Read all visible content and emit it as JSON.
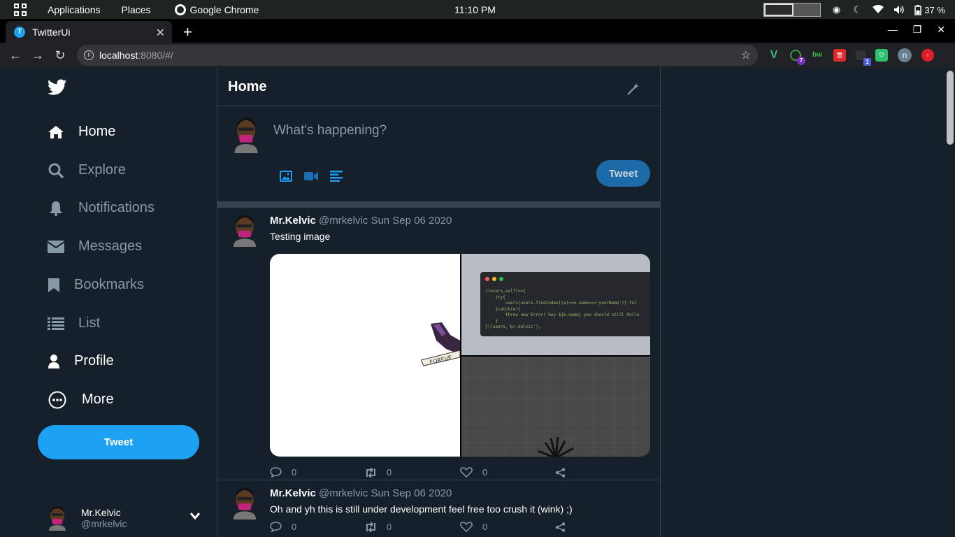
{
  "os_bar": {
    "applications": "Applications",
    "places": "Places",
    "chrome": "Google Chrome",
    "clock": "11:10 PM",
    "battery": "37 %"
  },
  "browser": {
    "tab_title": "TwitterUi",
    "tab_favicon": "T",
    "url_host": "localhost",
    "url_rest": ":8080/#/",
    "profile_initial": "n",
    "ext_badge_1": "7",
    "ext_badge_2": "1",
    "ext_bw": "bw"
  },
  "sidebar": {
    "items": [
      {
        "label": "Home",
        "icon": "home-icon"
      },
      {
        "label": "Explore",
        "icon": "search-icon"
      },
      {
        "label": "Notifications",
        "icon": "bell-icon"
      },
      {
        "label": "Messages",
        "icon": "envelope-icon"
      },
      {
        "label": "Bookmarks",
        "icon": "bookmark-icon"
      },
      {
        "label": "List",
        "icon": "list-icon"
      },
      {
        "label": "Profile",
        "icon": "user-icon"
      },
      {
        "label": "More",
        "icon": "more-icon"
      }
    ],
    "tweet_button": "Tweet",
    "account_name": "Mr.Kelvic",
    "account_handle": "@mrkelvic"
  },
  "main": {
    "title": "Home",
    "compose_placeholder": "What's happening?",
    "compose_tweet_button": "Tweet"
  },
  "tweets": [
    {
      "name": "Mr.Kelvic",
      "meta": "@mrkelvic Sun Sep 06 2020",
      "text": "Testing image",
      "replies": "0",
      "retweets": "0",
      "likes": "0"
    },
    {
      "name": "Mr.Kelvic",
      "meta": "@mrkelvic Sun Sep 06 2020",
      "text": "Oh and yh this is still under development feel free too crush it (wink) ;)",
      "replies": "0",
      "retweets": "0",
      "likes": "0"
    }
  ],
  "colors": {
    "background": "#15202b",
    "accent": "#1da1f2",
    "muted": "#8899a6",
    "border": "#38444d"
  }
}
